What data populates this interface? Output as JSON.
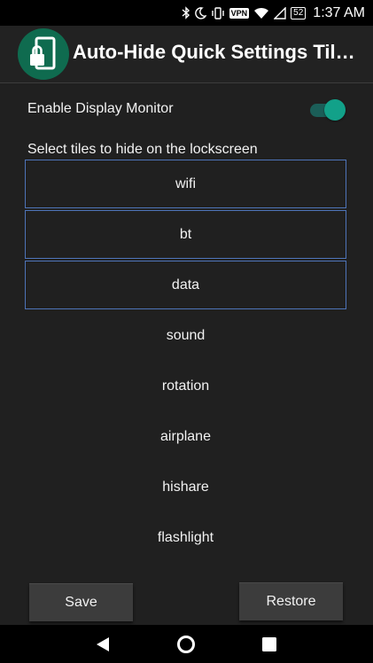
{
  "status_bar": {
    "battery": "52",
    "vpn": "VPN",
    "time": "1:37 AM",
    "icons": [
      "bluetooth-icon",
      "moon-icon",
      "vibrate-icon",
      "vpn-icon",
      "wifi-icon",
      "cellular-icon",
      "battery-icon"
    ]
  },
  "app_bar": {
    "title": "Auto-Hide Quick Settings Til…",
    "logo_icon": "phone-lock-icon",
    "logo_color": "#0f6b4f"
  },
  "settings": {
    "display_monitor_label": "Enable Display Monitor",
    "display_monitor_enabled": true,
    "accent_color": "#12a189"
  },
  "tiles_section": {
    "label": "Select tiles to hide on the lockscreen",
    "selected_border_color": "#4e74b8",
    "tiles": [
      {
        "label": "wifi",
        "selected": true
      },
      {
        "label": "bt",
        "selected": true
      },
      {
        "label": "data",
        "selected": true
      },
      {
        "label": "sound",
        "selected": false
      },
      {
        "label": "rotation",
        "selected": false
      },
      {
        "label": "airplane",
        "selected": false
      },
      {
        "label": "hishare",
        "selected": false
      },
      {
        "label": "flashlight",
        "selected": false
      }
    ]
  },
  "actions": {
    "save_label": "Save",
    "restore_label": "Restore"
  },
  "nav_bar": {
    "icons": [
      "back-icon",
      "home-icon",
      "recents-icon"
    ]
  }
}
